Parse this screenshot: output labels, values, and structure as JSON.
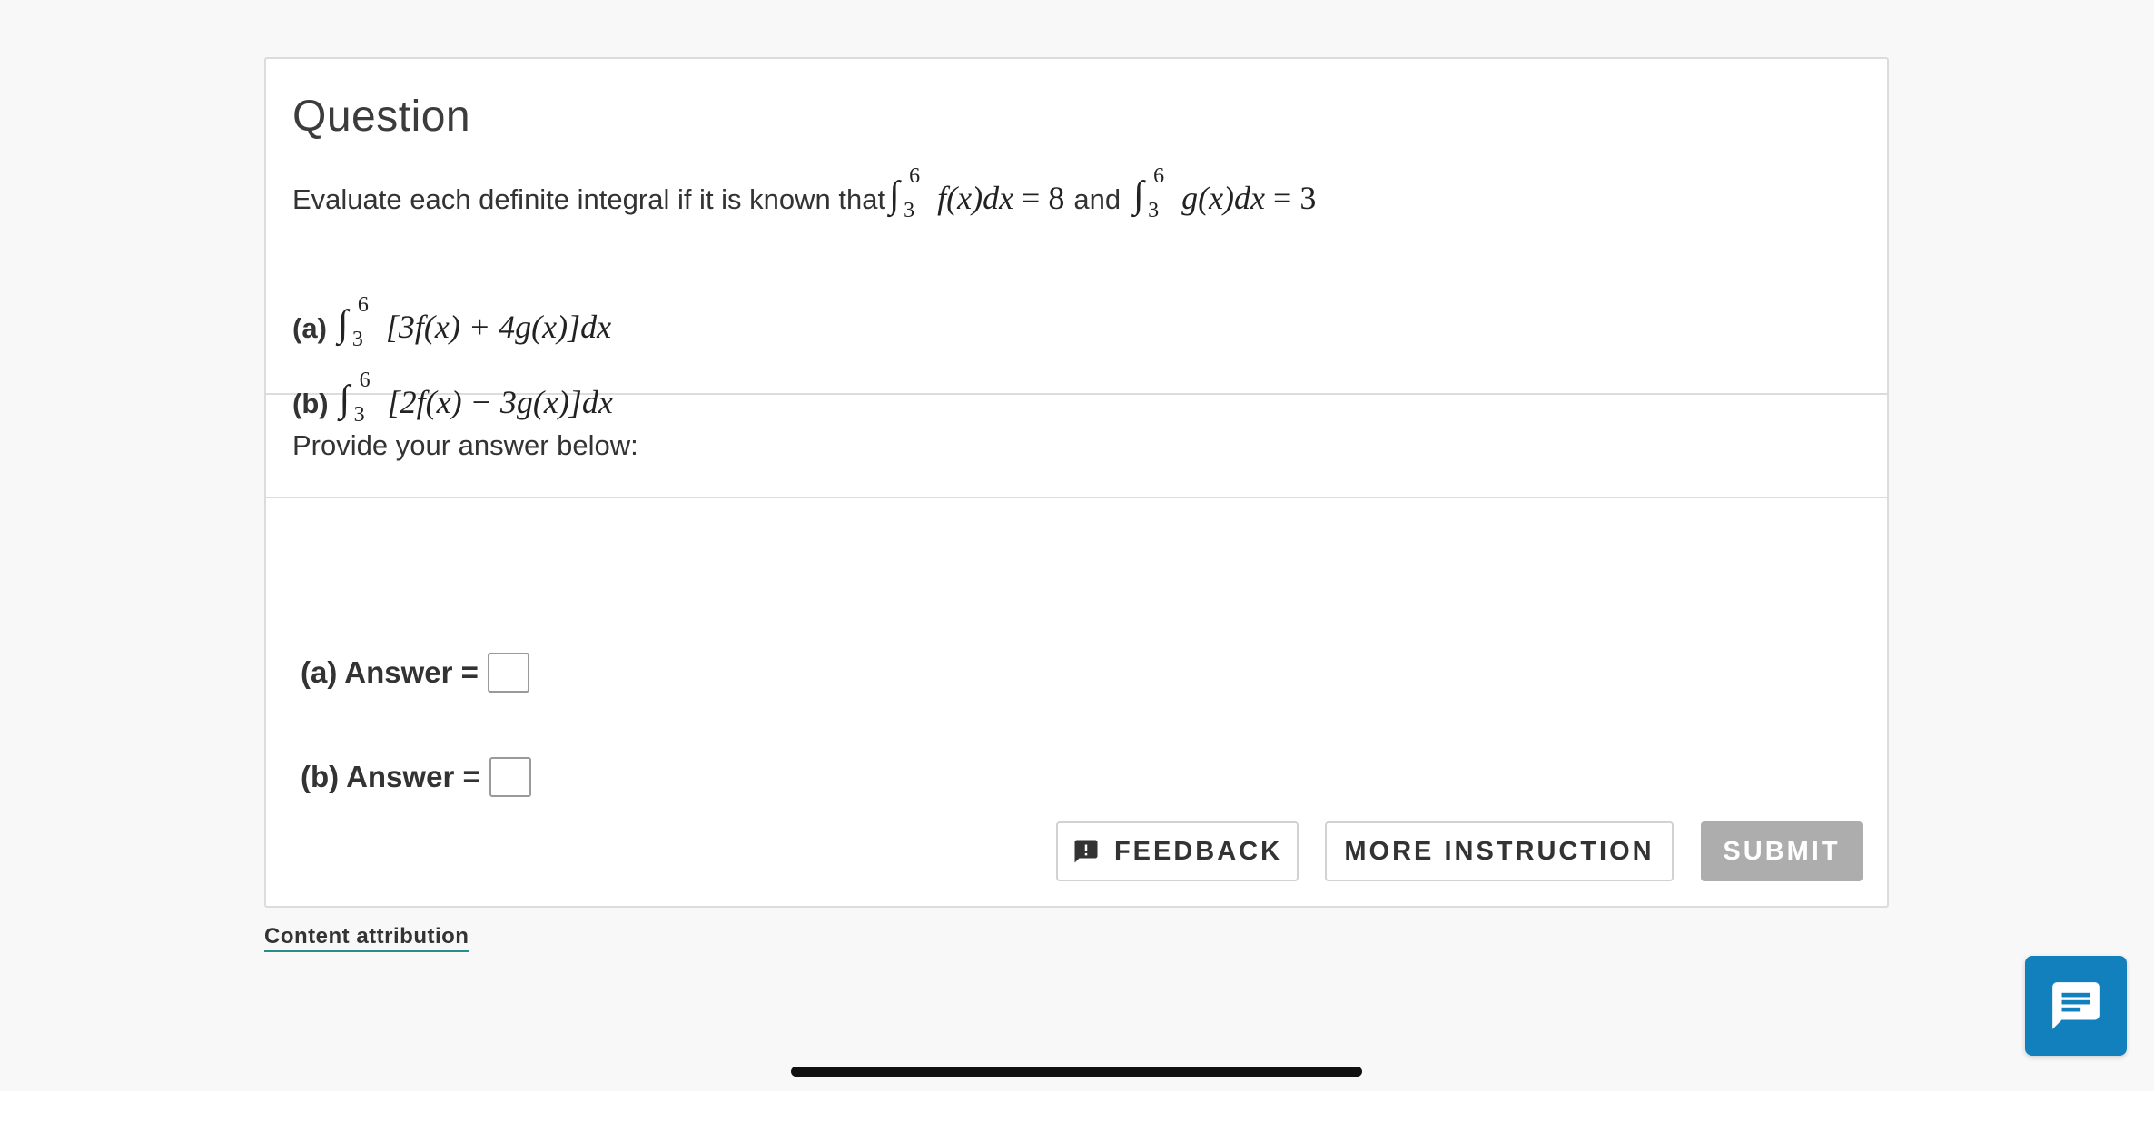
{
  "question": {
    "title": "Question",
    "prompt_text": "Evaluate each definite integral if it is known that",
    "integral_f": {
      "lower": "3",
      "upper": "6",
      "integrand": "f(x)dx",
      "equals": "= 8"
    },
    "connector": "and",
    "integral_g": {
      "lower": "3",
      "upper": "6",
      "integrand": "g(x)dx",
      "equals": "= 3"
    },
    "parts": [
      {
        "label": "(a)",
        "lower": "3",
        "upper": "6",
        "integrand": "[3f(x) + 4g(x)]dx"
      },
      {
        "label": "(b)",
        "lower": "3",
        "upper": "6",
        "integrand": "[2f(x) − 3g(x)]dx"
      }
    ]
  },
  "provide": {
    "text": "Provide your answer below:"
  },
  "answers": [
    {
      "label": "(a) Answer =",
      "value": ""
    },
    {
      "label": "(b) Answer =",
      "value": ""
    }
  ],
  "buttons": {
    "feedback": "FEEDBACK",
    "more_instruction": "MORE INSTRUCTION",
    "submit": "SUBMIT"
  },
  "footer": {
    "attribution": "Content attribution"
  },
  "icons": {
    "feedback": "feedback-icon",
    "chat": "chat-bubble-icon"
  },
  "colors": {
    "submit_disabled": "#adadad",
    "chat_button": "#1380be",
    "attribution_underline": "#2a8c8c"
  }
}
